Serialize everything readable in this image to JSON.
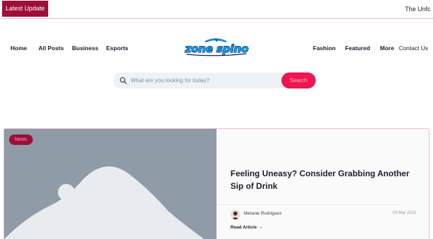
{
  "topbar": {
    "latest_label": "Latest Update",
    "ticker_text": "The Unfc"
  },
  "nav": {
    "left": [
      "Home",
      "All Posts",
      "Business",
      "Esports"
    ],
    "right": [
      "Fashion",
      "Featured",
      "More",
      "Contact Us"
    ]
  },
  "logo": {
    "text_line1": "zone",
    "text_line2": "spino"
  },
  "search": {
    "placeholder": "What are you looking for today?",
    "button_label": "Search"
  },
  "article": {
    "badge": "News",
    "title": "Feeling Uneasy? Consider Grabbing Another Sip of Drink",
    "author": "Melanie Rodriguez",
    "date": "09 Mar 2026",
    "read_more": "Read Article →"
  },
  "colors": {
    "accent": "#f0144f",
    "brand_dark": "#9e0f3a",
    "image_placeholder": "#8f9ba6"
  }
}
